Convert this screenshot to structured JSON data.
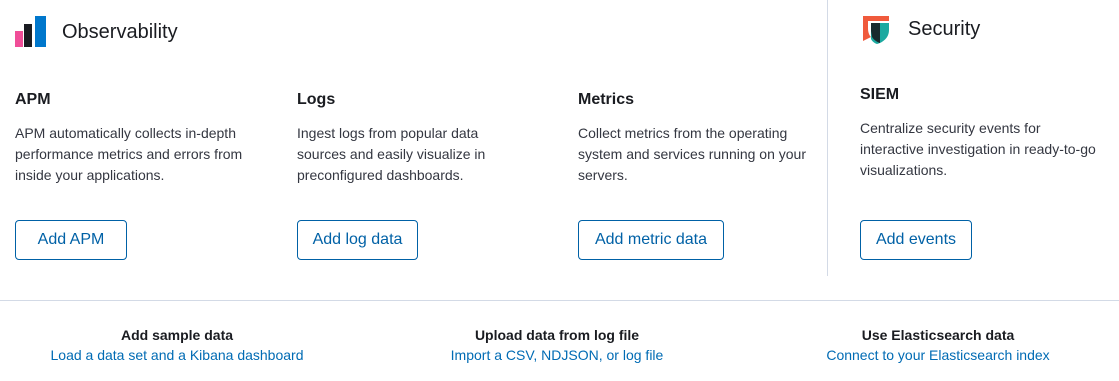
{
  "observability": {
    "title": "Observability",
    "logo_colors": [
      "#f04e98",
      "#1a1c21",
      "#0077cc"
    ],
    "cards": [
      {
        "title": "APM",
        "description": "APM automatically collects in-depth performance metrics and errors from inside your applications.",
        "button": "Add APM"
      },
      {
        "title": "Logs",
        "description": "Ingest logs from popular data sources and easily visualize in preconfigured dashboards.",
        "button": "Add log data"
      },
      {
        "title": "Metrics",
        "description": "Collect metrics from the operating system and services running on your servers.",
        "button": "Add metric data"
      }
    ]
  },
  "security": {
    "title": "Security",
    "logo_colors": [
      "#f05a3c",
      "#1ba9a0",
      "#1a1c21"
    ],
    "cards": [
      {
        "title": "SIEM",
        "description": "Centralize security events for interactive investigation in ready-to-go visualizations.",
        "button": "Add events"
      }
    ]
  },
  "footer": {
    "items": [
      {
        "title": "Add sample data",
        "link": "Load a data set and a Kibana dashboard"
      },
      {
        "title": "Upload data from log file",
        "link": "Import a CSV, NDJSON, or log file"
      },
      {
        "title": "Use Elasticsearch data",
        "link": "Connect to your Elasticsearch index"
      }
    ]
  },
  "colors": {
    "link": "#006bb4",
    "button_border": "#0061a6",
    "divider": "#d3dae6"
  }
}
